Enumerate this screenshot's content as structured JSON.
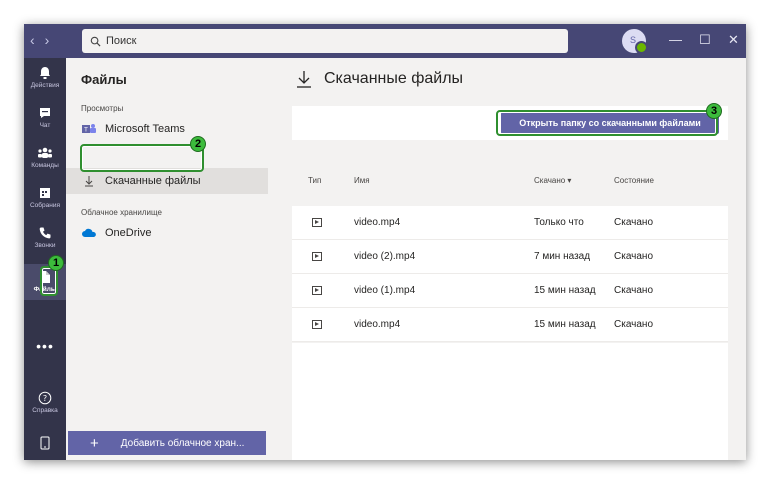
{
  "titlebar": {
    "search_placeholder": "Поиск",
    "avatar_initial": "S"
  },
  "appbar": [
    {
      "label": "Действия",
      "icon": "bell-icon"
    },
    {
      "label": "Чат",
      "icon": "chat-icon"
    },
    {
      "label": "Команды",
      "icon": "teams-icon"
    },
    {
      "label": "Собрания",
      "icon": "calendar-icon"
    },
    {
      "label": "Звонки",
      "icon": "phone-icon"
    },
    {
      "label": "Файлы",
      "icon": "file-icon",
      "active": true
    },
    {
      "label": "Справка",
      "icon": "help-icon"
    }
  ],
  "files_pane": {
    "title": "Файлы",
    "views_label": "Просмотры",
    "views": [
      {
        "label": "Microsoft Teams",
        "icon": "microsoft-teams-icon"
      },
      {
        "label": "Скачанные файлы",
        "icon": "download-icon",
        "selected": true
      }
    ],
    "cloud_label": "Облачное хранилище",
    "cloud": [
      {
        "label": "OneDrive",
        "icon": "onedrive-cloud-icon"
      }
    ],
    "add_cloud_label": "Добавить облачное хран..."
  },
  "main": {
    "title": "Скачанные файлы",
    "open_folder_button": "Открыть папку со скачанными файлами",
    "columns": {
      "type": "Тип",
      "name": "Имя",
      "downloaded": "Скачано ▾",
      "state": "Состояние"
    },
    "rows": [
      {
        "name": "video.mp4",
        "downloaded": "Только что",
        "state": "Скачано"
      },
      {
        "name": "video (2).mp4",
        "downloaded": "7 мин назад",
        "state": "Скачано"
      },
      {
        "name": "video (1).mp4",
        "downloaded": "15 мин назад",
        "state": "Скачано"
      },
      {
        "name": "video.mp4",
        "downloaded": "15 мин назад",
        "state": "Скачано"
      }
    ]
  },
  "annotations": [
    "1",
    "2",
    "3"
  ],
  "colors": {
    "accent": "#6264a7",
    "titlebar": "#464775",
    "appbar": "#33344a",
    "highlight": "#2f8f2f"
  }
}
